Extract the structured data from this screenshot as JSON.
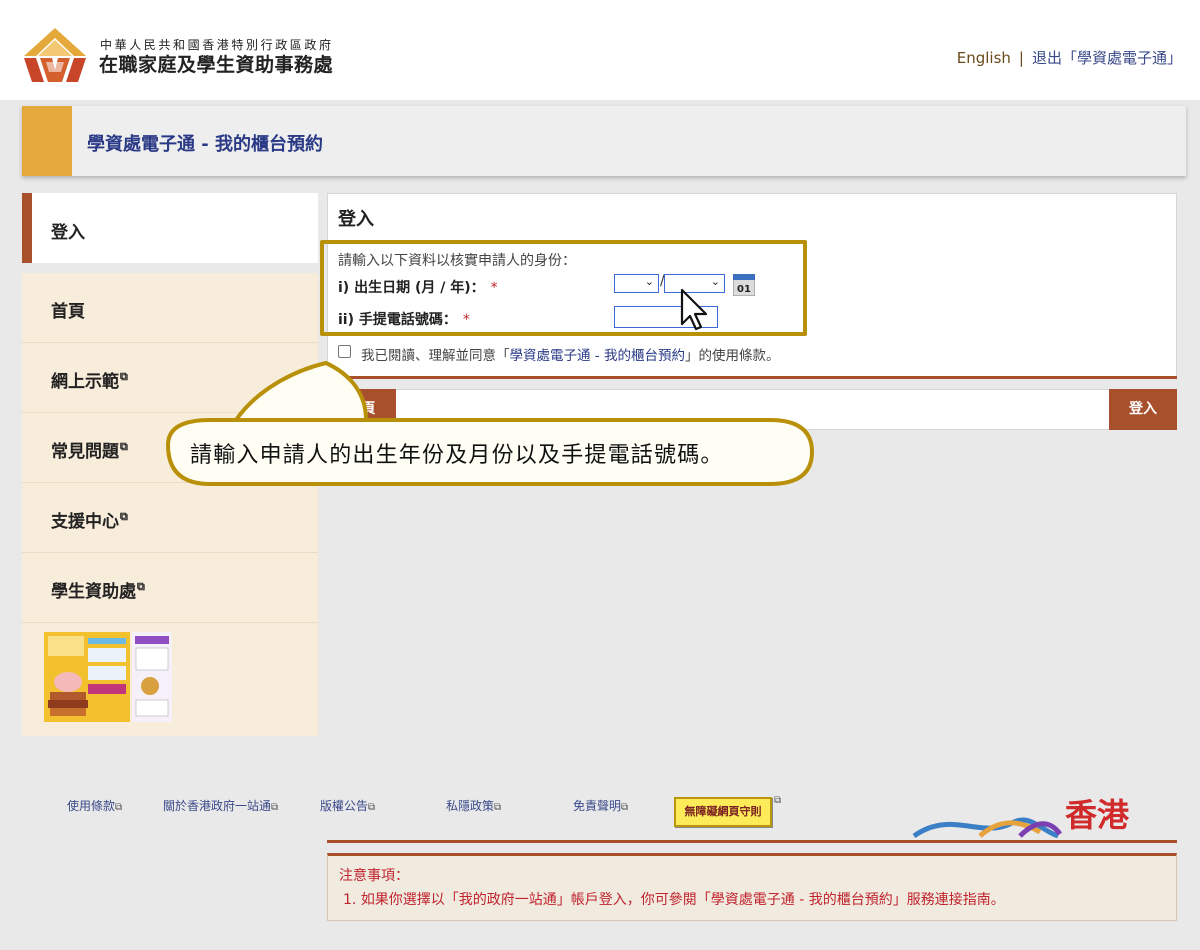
{
  "header": {
    "gov_name": "中華人民共和國香港特別行政區政府",
    "office_name": "在職家庭及學生資助事務處",
    "lang_link": "English",
    "separator": "|",
    "logout_link": "退出「學資處電子通」"
  },
  "banner": {
    "title": "學資處電子通 - 我的櫃台預約"
  },
  "sidebar": {
    "active_item": "登入",
    "items": [
      {
        "label": "首頁",
        "external": false
      },
      {
        "label": "網上示範",
        "external": true
      },
      {
        "label": "常見問題",
        "external": true
      },
      {
        "label": "支援中心",
        "external": true
      },
      {
        "label": "學生資助處",
        "external": true
      }
    ],
    "external_icon": "external-link-icon"
  },
  "login": {
    "title": "登入",
    "prompt": "請輸入以下資料以核實申請人的身份：",
    "dob_label": "i) 出生日期 (月 / 年)：",
    "phone_label": "ii) 手提電話號碼：",
    "required_mark": "*",
    "month_value": "",
    "date_separator": "/",
    "year_value": "",
    "phone_value": "",
    "calendar_day": "01",
    "agree_prefix": "我已閱讀、理解並同意「",
    "agree_link": "學資處電子通 - 我的櫃台預約",
    "agree_suffix": "」的使用條款。",
    "agree_checked": false
  },
  "actions": {
    "home_label": "主頁",
    "login_label": "登入"
  },
  "callout": {
    "text": "請輸入申請人的出生年份及月份以及手提電話號碼。"
  },
  "footer": {
    "links": [
      "使用條款",
      "關於香港政府一站通",
      "版權公告",
      "私隱政策",
      "免責聲明"
    ],
    "wcag_badge": "無障礙網頁守則",
    "brand_text": "香港"
  },
  "notice": {
    "title": "注意事項：",
    "item_number": "1.",
    "item_text": "如果你選擇以「我的政府一站通」帳戶登入，你可參閱「學資處電子通 - 我的櫃台預約」服務連接指南。"
  },
  "colors": {
    "accent_brown": "#a8502c",
    "banner_gold": "#e5a93b",
    "highlight_gold": "#b8900a",
    "link_blue": "#2a3a86",
    "notice_red": "#c0242e",
    "sidebar_bg": "#f8ecdb"
  }
}
